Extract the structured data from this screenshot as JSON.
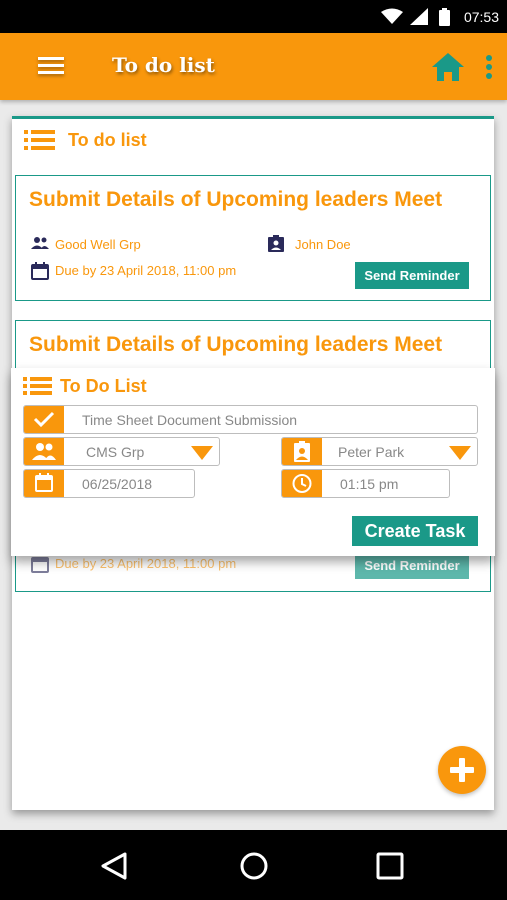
{
  "status_bar": {
    "time": "07:53",
    "icons": [
      "wifi-icon",
      "signal-icon",
      "battery-icon"
    ]
  },
  "app_bar": {
    "title": "To do list",
    "menu_icon": "hamburger-menu-icon",
    "home_icon": "home-icon",
    "more_icon": "more-vertical-icon"
  },
  "panel": {
    "title": "To do list",
    "icon": "list-icon"
  },
  "tasks": [
    {
      "title": "Submit Details of Upcoming leaders Meet",
      "group": "Good Well Grp",
      "assignee": "John Doe",
      "due": "Due by 23 April 2018, 11:00 pm",
      "button": "Send Reminder"
    },
    {
      "title": "Submit Details of Upcoming leaders Meet",
      "due": "Due by 23 April 2018, 11:00 pm",
      "button": "Send Reminder"
    }
  ],
  "form": {
    "title": "To Do List",
    "task_name": "Time Sheet Document Submission",
    "group": "CMS Grp",
    "person": "Peter Park",
    "date": "06/25/2018",
    "time": "01:15 pm",
    "submit": "Create Task"
  },
  "colors": {
    "accent": "#f9970c",
    "teal": "#1a9988"
  }
}
